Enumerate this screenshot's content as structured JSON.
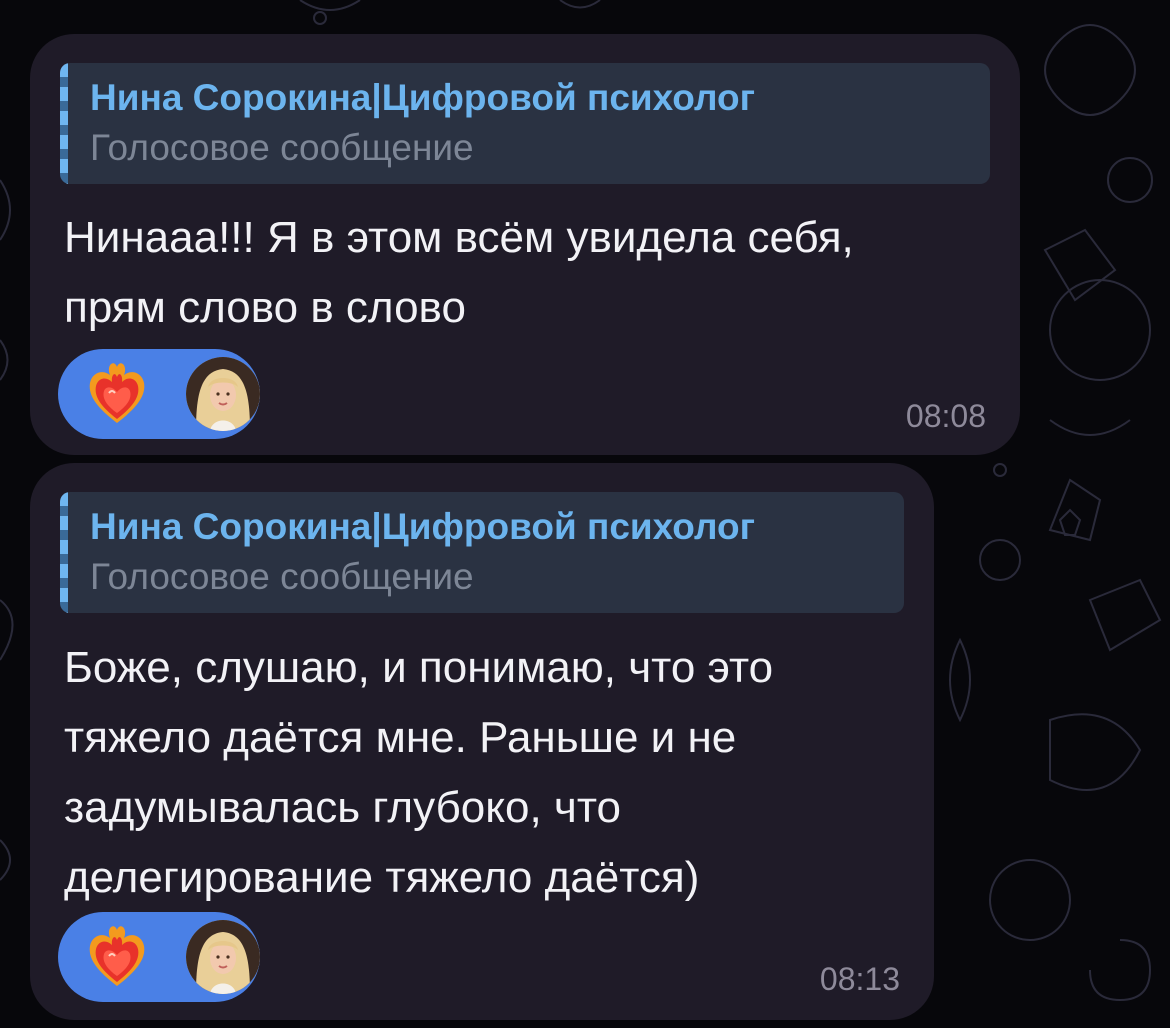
{
  "colors": {
    "background": "#07070b",
    "bubble": "#1f1b28",
    "reply_background": "#2a3242",
    "reply_author": "#6cb4ee",
    "reply_type": "#7d8696",
    "message_text": "#f2f2f6",
    "reaction_pill": "#4a80e6",
    "timestamp": "#8e8a9a"
  },
  "messages": [
    {
      "reply": {
        "author": "Нина Сорокина|Цифровой психолог",
        "type": "Голосовое сообщение"
      },
      "lines": [
        "Нинааа!!! Я в этом всём увидела себя,",
        "прям слово в слово"
      ],
      "reaction": {
        "emoji_icon": "heart-on-fire-icon",
        "reactor_avatar": "user-avatar"
      },
      "time": "08:08"
    },
    {
      "reply": {
        "author": "Нина Сорокина|Цифровой психолог",
        "type": "Голосовое сообщение"
      },
      "lines": [
        "Боже, слушаю, и понимаю, что это",
        "тяжело даётся мне. Раньше и не",
        "задумывалась глубоко, что",
        "делегирование тяжело даётся)"
      ],
      "reaction": {
        "emoji_icon": "heart-on-fire-icon",
        "reactor_avatar": "user-avatar"
      },
      "time": "08:13"
    }
  ]
}
